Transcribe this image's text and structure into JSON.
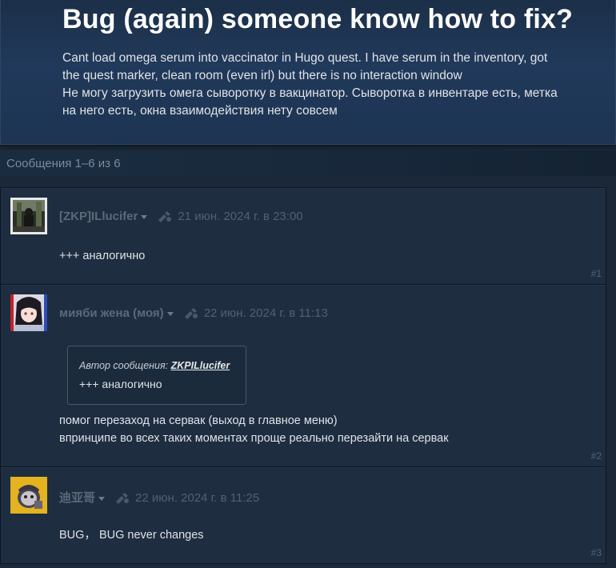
{
  "topic": {
    "title": "Bug (again) someone know how to fix?",
    "body_lines": [
      "Cant load omega serum into vaccinator in Hugo quest. I have serum in the inventory, got",
      "the quest marker, clean room (even irl) but there is no interaction window",
      "Не могу загрузить омега сыворотку в вакцинатор. Сыворотка в инвентаре есть, метка",
      "на него есть, окна взаимодействия нету совсем"
    ]
  },
  "message_count": "Сообщения 1–6 из 6",
  "posts": [
    {
      "author": "[ZKP]ILlucifer",
      "date": "21 июн. 2024 г. в 23:00",
      "lines": [
        "+++ аналогично"
      ],
      "number": "#1",
      "avatar_icon": "avatar-dark-figure-icon"
    },
    {
      "author": "мияби жена (моя)",
      "date": "22 июн. 2024 г. в 11:13",
      "quote": {
        "prefix": "Автор сообщения: ",
        "author": "ZKPILlucifer",
        "text": "+++ аналогично"
      },
      "lines": [
        "помог перезаход на сервак (выход в главное меню)",
        "впринципе во всех таких моментах проще реально перезайти на сервак"
      ],
      "number": "#2",
      "avatar_icon": "avatar-anime-girl-icon"
    },
    {
      "author": "迪亚哥",
      "date": "22 июн. 2024 г. в 11:25",
      "lines": [
        "BUG， BUG never changes"
      ],
      "number": "#3",
      "avatar_icon": "avatar-yellow-cartoon-icon"
    }
  ],
  "colors": {
    "page_bg": "#1b2838",
    "post_bg": "#1e2d40",
    "author_text": "#5c6978",
    "body_text": "#dfe3e6"
  }
}
